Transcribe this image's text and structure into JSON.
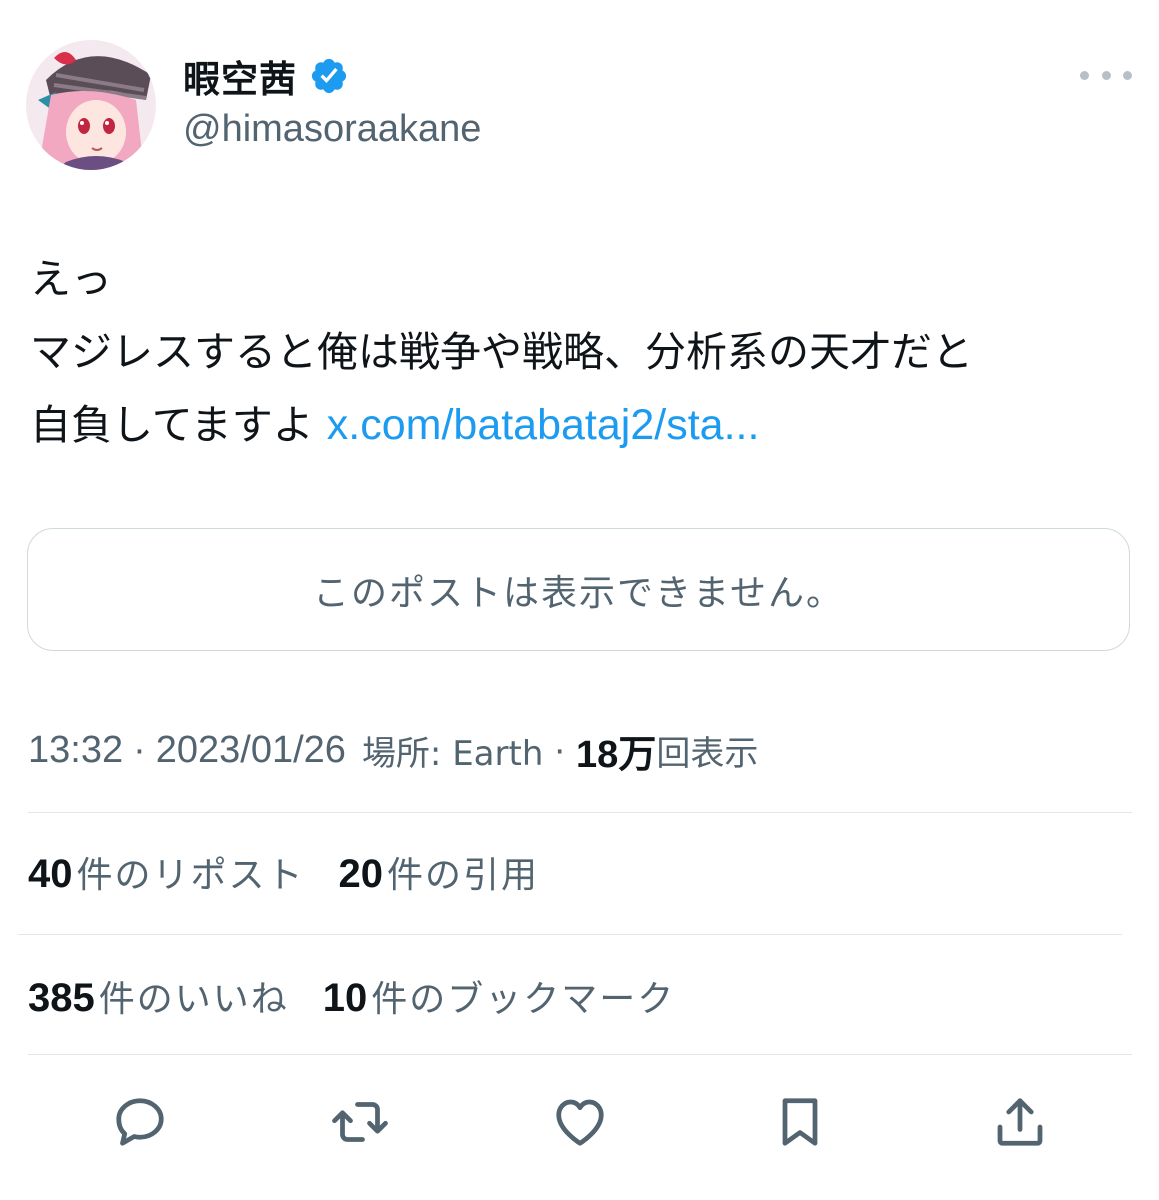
{
  "author": {
    "display_name": "暇空茜",
    "handle": "@himasoraakane",
    "verified_icon": "verified-badge-icon",
    "avatar": "avatar-anime-girl-pink-hair"
  },
  "tweet": {
    "lines": [
      "えっ",
      "マジレスすると俺は戦争や戦略、分析系の天才だと",
      "自負してますよ"
    ],
    "link_text": "x.com/batabataj2/sta..."
  },
  "quoted_post": {
    "unavailable_text": "このポストは表示できません。"
  },
  "meta": {
    "time": "13:32",
    "date": "2023/01/26",
    "location_label": "場所: Earth",
    "views_count": "18万",
    "views_label": "回表示",
    "separator": "·"
  },
  "stats": {
    "reposts": {
      "count": "40",
      "label": "件のリポスト"
    },
    "quotes": {
      "count": "20",
      "label": "件の引用"
    },
    "likes": {
      "count": "385",
      "label": "件のいいね"
    },
    "bookmarks": {
      "count": "10",
      "label": "件のブックマーク"
    }
  },
  "actions": {
    "icons": [
      "reply-icon",
      "repost-icon",
      "like-icon",
      "bookmark-icon",
      "share-icon"
    ]
  },
  "colors": {
    "link": "#1d9bf0",
    "verified": "#1d9bf0",
    "secondary_text": "#536471",
    "primary_text": "#0f1419",
    "border": "#cfd9de"
  }
}
